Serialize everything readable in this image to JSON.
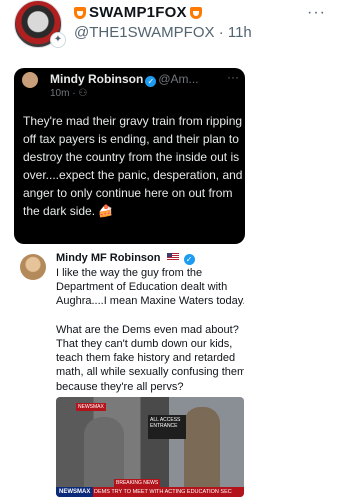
{
  "post": {
    "display_name": "SWAMP1FOX",
    "handle": "@THE1SWAMPFOX",
    "separator": "·",
    "time": "11h",
    "more_icon": "more-dots-icon"
  },
  "embedded_tweet": {
    "name": "Mindy Robinson",
    "handle": "@Am...",
    "time": "10m",
    "separator": "·",
    "text": "They're mad their gravy train from ripping off tax payers is ending, and their plan to destroy the country from the inside out is over....expect the panic, desperation, and anger to only continue here on out from the dark side. 🍰"
  },
  "quoted_tweet": {
    "name": "Mindy MF Robinson",
    "text": "I like the way the guy from the Department of Education dealt with Aughra....I mean Maxine Waters today.\n\nWhat are the Dems even mad about? That they can't dumb down our kids, teach them fake history and retarded math, all while sexually confusing them because they're all pervs?",
    "image": {
      "sign_text": "ALL ACCESS ENTRANCE",
      "tag_text": "NEWSMAX",
      "breaking_text": "BREAKING NEWS",
      "network": "NEWSMAX",
      "headline": "DEMS TRY TO MEET WITH ACTING EDUCATION SEC"
    }
  }
}
